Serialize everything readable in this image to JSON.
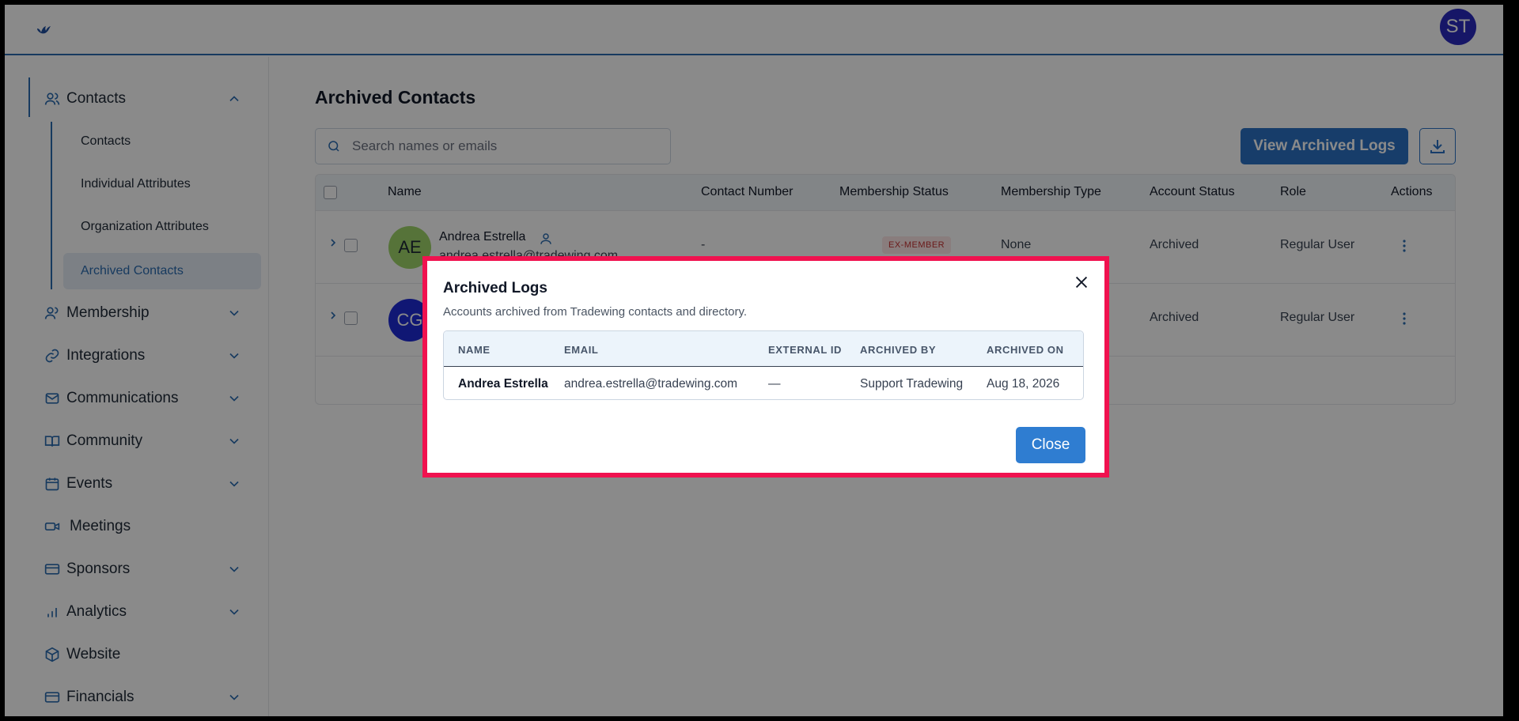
{
  "header": {
    "user_initials": "ST"
  },
  "sidebar": {
    "contacts_label": "Contacts",
    "sub_items": [
      {
        "label": "Contacts"
      },
      {
        "label": "Individual Attributes"
      },
      {
        "label": "Organization Attributes"
      },
      {
        "label": "Archived Contacts",
        "active": true
      }
    ],
    "items": [
      {
        "label": "Membership"
      },
      {
        "label": "Integrations"
      },
      {
        "label": "Communications"
      },
      {
        "label": "Community"
      },
      {
        "label": "Events"
      },
      {
        "label": "Meetings"
      },
      {
        "label": "Sponsors"
      },
      {
        "label": "Analytics"
      },
      {
        "label": "Website"
      },
      {
        "label": "Financials"
      }
    ]
  },
  "main": {
    "title": "Archived Contacts",
    "search_placeholder": "Search names or emails",
    "view_logs_label": "View Archived Logs",
    "columns": [
      "Name",
      "Contact Number",
      "Membership Status",
      "Membership Type",
      "Account Status",
      "Role",
      "Actions"
    ],
    "rows": [
      {
        "initials": "AE",
        "name": "Andrea Estrella",
        "email_partial": "andrea.estrella@tradewing.com",
        "contact_number": "-",
        "membership_status": "EX-MEMBER",
        "membership_type": "None",
        "account_status": "Archived",
        "role": "Regular User"
      },
      {
        "initials": "CG",
        "account_status": "Archived",
        "role": "Regular User"
      }
    ]
  },
  "modal": {
    "title": "Archived Logs",
    "subtitle": "Accounts archived from Tradewing contacts and directory.",
    "columns": [
      "NAME",
      "EMAIL",
      "EXTERNAL ID",
      "ARCHIVED BY",
      "ARCHIVED ON"
    ],
    "rows": [
      {
        "name": "Andrea Estrella",
        "email": "andrea.estrella@tradewing.com",
        "external_id": "—",
        "archived_by": "Support Tradewing",
        "archived_on": "Aug 18, 2026"
      }
    ],
    "close_label": "Close"
  }
}
